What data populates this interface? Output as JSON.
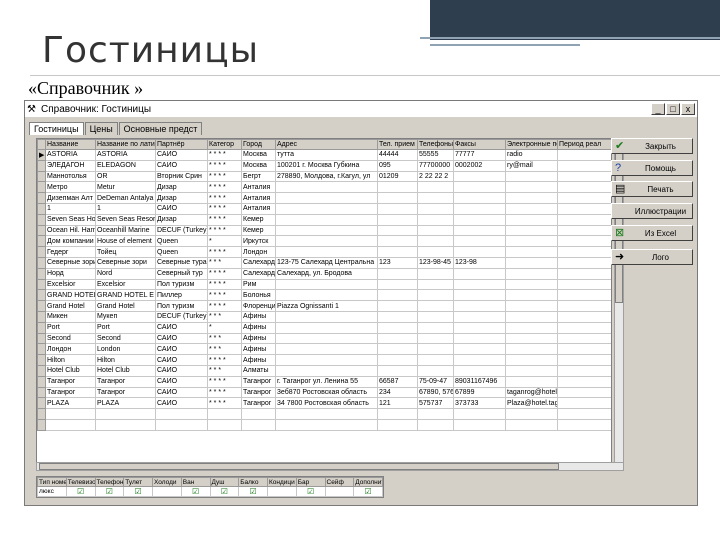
{
  "slide": {
    "title": "Гостиницы",
    "subtitle": "«Справочник »"
  },
  "window": {
    "title": "Справочник: Гостиницы",
    "buttons": [
      "_",
      "□",
      "x"
    ]
  },
  "tabs": [
    "Гостиницы",
    "Цены",
    "Основные предст"
  ],
  "columns": [
    "Название",
    "Название по латин",
    "Партнёр",
    "Категор",
    "Город",
    "Адрес",
    "Тел. прием",
    "Телефоны",
    "Факсы",
    "Электронные поч",
    "Период реал"
  ],
  "rows": [
    [
      "ASTORIA",
      "ASTORIA",
      "САИО",
      "* * * *",
      "Москва",
      "тутта",
      "44444",
      "55555",
      "77777",
      "radio",
      ""
    ],
    [
      "ЭЛЕДАГОН",
      "ELEDAGON",
      "САИО",
      "* * * *",
      "Москва",
      "100201 г. Москва Губкина",
      "095",
      "77700000",
      "0002002",
      "ry@mail",
      ""
    ],
    [
      "Маннотолья",
      "OR",
      "Вторник Срин",
      "* * * *",
      "Бегрт",
      "278890, Молдова, г.Кагул, ул",
      "01209",
      "2 22 22 2",
      "",
      "",
      ""
    ],
    [
      "Метро",
      "Metur",
      "Дизар",
      "* * * *",
      "Анталия",
      "",
      "",
      "",
      "",
      "",
      ""
    ],
    [
      "Дизепман Алт",
      "DeDeman Antalya H",
      "Дизар",
      "* * * *",
      "Анталия",
      "",
      "",
      "",
      "",
      "",
      ""
    ],
    [
      "1",
      "1",
      "САИО",
      "* * * *",
      "Анталия",
      "",
      "",
      "",
      "",
      "",
      ""
    ],
    [
      "Seven Seas Ho",
      "Seven Seas Resort",
      "Дизар",
      "* * * *",
      "Кемер",
      "",
      "",
      "",
      "",
      "",
      ""
    ],
    [
      "Ocean Hil. Ham",
      "Oceanhill Marine",
      "DECUF (Turkey)",
      "* * * *",
      "Кемер",
      "",
      "",
      "",
      "",
      "",
      ""
    ],
    [
      "Дом компании",
      "House of element",
      "Queen",
      "*",
      "Иркутск",
      "",
      "",
      "",
      "",
      "",
      ""
    ],
    [
      "Гедерг",
      "Тойец",
      "Queen",
      "* * * *",
      "Лондон",
      "",
      "",
      "",
      "",
      "",
      ""
    ],
    [
      "Северные зори",
      "Северные зори",
      "Северные тура",
      "* * *",
      "Салехард",
      "123-75 Салехард Центральна",
      "123",
      "123-98-45",
      "123-98",
      "",
      ""
    ],
    [
      "Норд",
      "Nord",
      "Северный тур",
      "* * * *",
      "Салехард",
      "Салехард, ул. Бродова",
      "",
      "",
      "",
      "",
      ""
    ],
    [
      "Еxcelsior",
      "Excelsior",
      "Пол туризм",
      "* * * *",
      "Рим",
      "",
      "",
      "",
      "",
      "",
      ""
    ],
    [
      "GRAND HOTEL",
      "GRAND HOTEL E",
      "Пиллер",
      "* * * *",
      "Болонья",
      "",
      "",
      "",
      "",
      "",
      ""
    ],
    [
      "Grand Hotel",
      "Grand Hotel",
      "Пол туризм",
      "* * * *",
      "Флоренция",
      "Piazza Ognissanti 1",
      "",
      "",
      "",
      "",
      ""
    ],
    [
      "Микен",
      "Мукеп",
      "DECUF (Turkey)",
      "* * *",
      "Афины",
      "",
      "",
      "",
      "",
      "",
      ""
    ],
    [
      "Port",
      "Port",
      "САИО",
      "*",
      "Афины",
      "",
      "",
      "",
      "",
      "",
      ""
    ],
    [
      "Second",
      "Second",
      "САИО",
      "* * *",
      "Афины",
      "",
      "",
      "",
      "",
      "",
      ""
    ],
    [
      "Лондон",
      "London",
      "САИО",
      "* * *",
      "Афины",
      "",
      "",
      "",
      "",
      "",
      ""
    ],
    [
      "Hilton",
      "Hilton",
      "САИО",
      "* * * *",
      "Афины",
      "",
      "",
      "",
      "",
      "",
      ""
    ],
    [
      "Hotel Club",
      "Hotel Club",
      "САИО",
      "* * *",
      "Алматы",
      "",
      "",
      "",
      "",
      "",
      ""
    ],
    [
      "Таганрог",
      "Таганрог",
      "САИО",
      "* * * *",
      "Таганрог",
      "г. Таганрог ул. Ленина 55",
      "66587",
      "75-09-47",
      "89031167496",
      "",
      ""
    ],
    [
      "Таганрог",
      "Таганрог",
      "САИО",
      "* * * *",
      "Таганрог",
      "3еб870 Ростовская область",
      "234",
      "67890, 5767",
      "67899",
      "taganrog@hotel.",
      ""
    ],
    [
      "PLAZA",
      "PLAZA",
      "САИО",
      "* * * *",
      "Таганрог",
      "34 7800 Ростовская область",
      "121",
      "575737",
      "373733",
      "Plaza@hotel.taga",
      ""
    ]
  ],
  "sub_columns": [
    "Тип номе",
    "Телевизо",
    "Телефон",
    "Тулет",
    "Холоди",
    "Ван",
    "Душ",
    "Балко",
    "Кондици",
    "Бар",
    "Сейф",
    "Дополнительные"
  ],
  "sub_row": {
    "type": "люкс",
    "checks": [
      true,
      true,
      true,
      false,
      true,
      true,
      true,
      false,
      true,
      false,
      true,
      false
    ]
  },
  "side_buttons": [
    {
      "label": "Закрыть",
      "icon": "✔"
    },
    {
      "label": "Помощь",
      "icon": "?"
    },
    {
      "label": "Печать",
      "icon": "▤"
    },
    {
      "label": "Иллюстрации",
      "icon": ""
    },
    {
      "label": "Из Excel",
      "icon": "⊠"
    },
    {
      "label": "Лого",
      "icon": "➜"
    }
  ]
}
